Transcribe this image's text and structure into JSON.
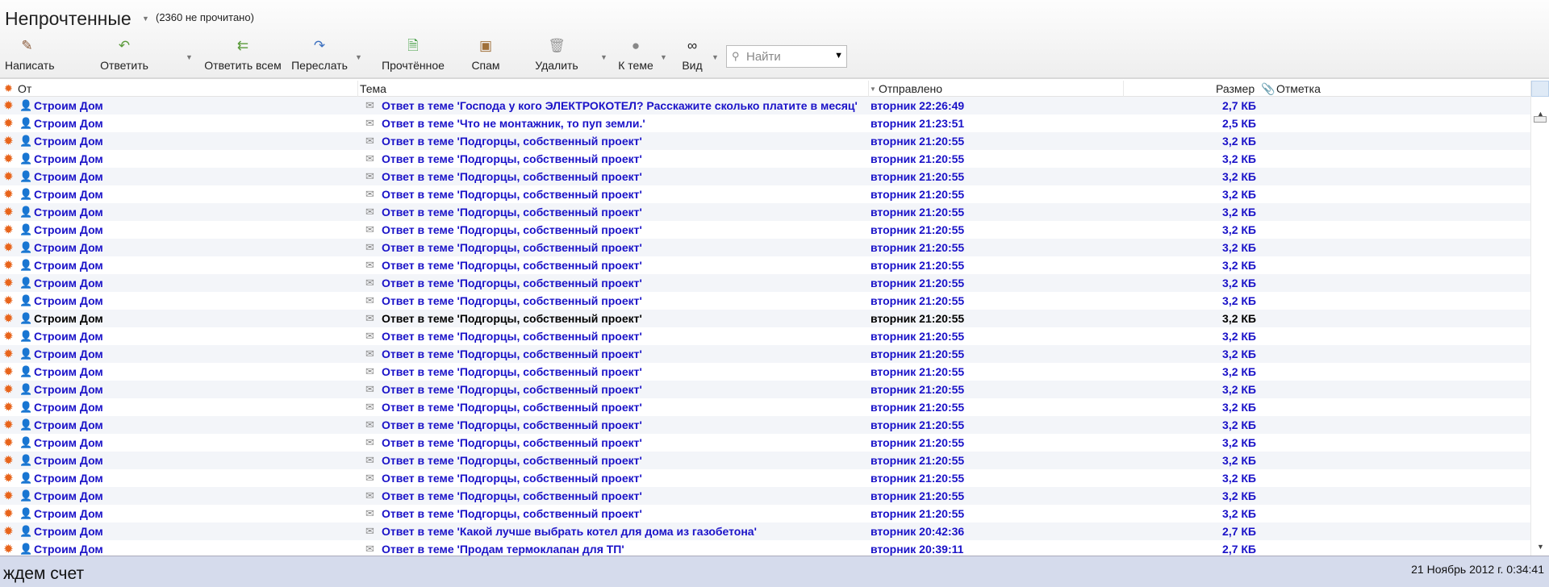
{
  "folder": {
    "title": "Непрочтенные",
    "unread": "(2360 не прочитано)"
  },
  "toolbar": {
    "compose": "Написать",
    "reply": "Ответить",
    "reply_all": "Ответить всем",
    "forward": "Переслать",
    "mark_read": "Прочтённое",
    "spam": "Спам",
    "delete": "Удалить",
    "thread": "К теме",
    "view": "Вид"
  },
  "search": {
    "placeholder": "Найти"
  },
  "columns": {
    "from": "От",
    "subject": "Тема",
    "sent": "Отправлено",
    "size": "Размер",
    "flag": "Отметка"
  },
  "messages": [
    {
      "from": "Строим Дом",
      "subject": "Ответ в теме 'Господа у кого ЭЛЕКТРОКОТЕЛ? Расскажите сколько платите в месяц'",
      "sent": "вторник 22:26:49",
      "size": "2,7 КБ",
      "read": false
    },
    {
      "from": "Строим Дом",
      "subject": "Ответ в теме 'Что не монтажник, то пуп земли.'",
      "sent": "вторник 21:23:51",
      "size": "2,5 КБ",
      "read": false
    },
    {
      "from": "Строим Дом",
      "subject": "Ответ в теме 'Подгорцы, собственный проект'",
      "sent": "вторник 21:20:55",
      "size": "3,2 КБ",
      "read": false
    },
    {
      "from": "Строим Дом",
      "subject": "Ответ в теме 'Подгорцы, собственный проект'",
      "sent": "вторник 21:20:55",
      "size": "3,2 КБ",
      "read": false
    },
    {
      "from": "Строим Дом",
      "subject": "Ответ в теме 'Подгорцы, собственный проект'",
      "sent": "вторник 21:20:55",
      "size": "3,2 КБ",
      "read": false
    },
    {
      "from": "Строим Дом",
      "subject": "Ответ в теме 'Подгорцы, собственный проект'",
      "sent": "вторник 21:20:55",
      "size": "3,2 КБ",
      "read": false
    },
    {
      "from": "Строим Дом",
      "subject": "Ответ в теме 'Подгорцы, собственный проект'",
      "sent": "вторник 21:20:55",
      "size": "3,2 КБ",
      "read": false
    },
    {
      "from": "Строим Дом",
      "subject": "Ответ в теме 'Подгорцы, собственный проект'",
      "sent": "вторник 21:20:55",
      "size": "3,2 КБ",
      "read": false
    },
    {
      "from": "Строим Дом",
      "subject": "Ответ в теме 'Подгорцы, собственный проект'",
      "sent": "вторник 21:20:55",
      "size": "3,2 КБ",
      "read": false
    },
    {
      "from": "Строим Дом",
      "subject": "Ответ в теме 'Подгорцы, собственный проект'",
      "sent": "вторник 21:20:55",
      "size": "3,2 КБ",
      "read": false
    },
    {
      "from": "Строим Дом",
      "subject": "Ответ в теме 'Подгорцы, собственный проект'",
      "sent": "вторник 21:20:55",
      "size": "3,2 КБ",
      "read": false
    },
    {
      "from": "Строим Дом",
      "subject": "Ответ в теме 'Подгорцы, собственный проект'",
      "sent": "вторник 21:20:55",
      "size": "3,2 КБ",
      "read": false
    },
    {
      "from": "Строим Дом",
      "subject": "Ответ в теме 'Подгорцы, собственный проект'",
      "sent": "вторник 21:20:55",
      "size": "3,2 КБ",
      "read": true
    },
    {
      "from": "Строим Дом",
      "subject": "Ответ в теме 'Подгорцы, собственный проект'",
      "sent": "вторник 21:20:55",
      "size": "3,2 КБ",
      "read": false
    },
    {
      "from": "Строим Дом",
      "subject": "Ответ в теме 'Подгорцы, собственный проект'",
      "sent": "вторник 21:20:55",
      "size": "3,2 КБ",
      "read": false
    },
    {
      "from": "Строим Дом",
      "subject": "Ответ в теме 'Подгорцы, собственный проект'",
      "sent": "вторник 21:20:55",
      "size": "3,2 КБ",
      "read": false
    },
    {
      "from": "Строим Дом",
      "subject": "Ответ в теме 'Подгорцы, собственный проект'",
      "sent": "вторник 21:20:55",
      "size": "3,2 КБ",
      "read": false
    },
    {
      "from": "Строим Дом",
      "subject": "Ответ в теме 'Подгорцы, собственный проект'",
      "sent": "вторник 21:20:55",
      "size": "3,2 КБ",
      "read": false
    },
    {
      "from": "Строим Дом",
      "subject": "Ответ в теме 'Подгорцы, собственный проект'",
      "sent": "вторник 21:20:55",
      "size": "3,2 КБ",
      "read": false
    },
    {
      "from": "Строим Дом",
      "subject": "Ответ в теме 'Подгорцы, собственный проект'",
      "sent": "вторник 21:20:55",
      "size": "3,2 КБ",
      "read": false
    },
    {
      "from": "Строим Дом",
      "subject": "Ответ в теме 'Подгорцы, собственный проект'",
      "sent": "вторник 21:20:55",
      "size": "3,2 КБ",
      "read": false
    },
    {
      "from": "Строим Дом",
      "subject": "Ответ в теме 'Подгорцы, собственный проект'",
      "sent": "вторник 21:20:55",
      "size": "3,2 КБ",
      "read": false
    },
    {
      "from": "Строим Дом",
      "subject": "Ответ в теме 'Подгорцы, собственный проект'",
      "sent": "вторник 21:20:55",
      "size": "3,2 КБ",
      "read": false
    },
    {
      "from": "Строим Дом",
      "subject": "Ответ в теме 'Подгорцы, собственный проект'",
      "sent": "вторник 21:20:55",
      "size": "3,2 КБ",
      "read": false
    },
    {
      "from": "Строим Дом",
      "subject": "Ответ в теме 'Какой лучше выбрать котел для дома из газобетона'",
      "sent": "вторник 20:42:36",
      "size": "2,7 КБ",
      "read": false
    },
    {
      "from": "Строим Дом",
      "subject": "Ответ в теме 'Продам термоклапан для ТП'",
      "sent": "вторник 20:39:11",
      "size": "2,7 КБ",
      "read": false
    }
  ],
  "status": {
    "text": "ждем счет",
    "datetime": "21 Ноябрь 2012 г. 0:34:41"
  }
}
